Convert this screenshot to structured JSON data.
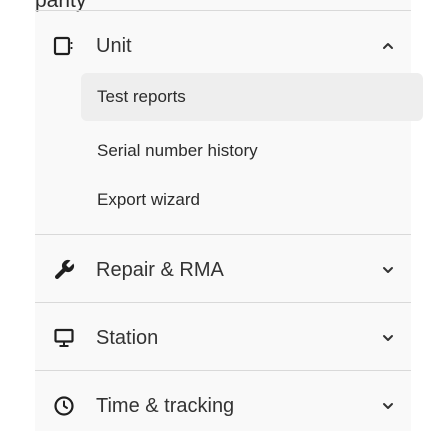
{
  "top_cut_text": "parity",
  "sections": [
    {
      "label": "Unit",
      "icon": "unit-icon",
      "expanded": true,
      "items": [
        {
          "label": "Test reports",
          "active": true
        },
        {
          "label": "Serial number history",
          "active": false
        },
        {
          "label": "Export wizard",
          "active": false
        }
      ]
    },
    {
      "label": "Repair & RMA",
      "icon": "wrench-icon",
      "expanded": false
    },
    {
      "label": "Station",
      "icon": "monitor-icon",
      "expanded": false
    },
    {
      "label": "Time & tracking",
      "icon": "clock-icon",
      "expanded": false
    }
  ],
  "colors": {
    "panel_bg": "#f9f9f9",
    "active_item_bg": "#eeeeee",
    "divider": "#d9d9d9",
    "text": "#333333"
  }
}
